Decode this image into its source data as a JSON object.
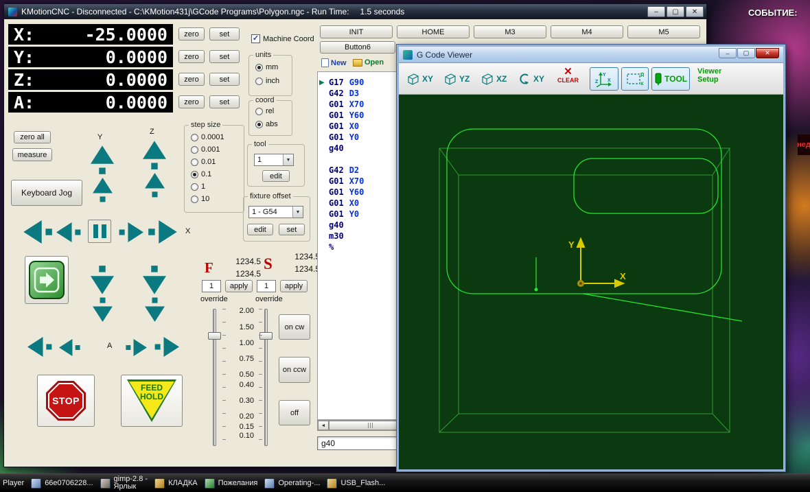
{
  "desktop": {
    "event_label": "СОБЫТИЕ:",
    "side_label": "нед"
  },
  "icons": {
    "minimize": "–",
    "maximize": "▢",
    "close": "✕",
    "play_marker": "▶",
    "scroll_left": "◄",
    "scroll_right": "►",
    "clear_x": "✕",
    "check": "✓",
    "dropdown_arrow": "▼"
  },
  "main_window": {
    "title": "KMotionCNC - Disconnected - C:\\KMotion431j\\GCode Programs\\Polygon.ngc -  Run Time:",
    "run_time": "1.5 seconds",
    "dro": {
      "rows": [
        {
          "label": "X:",
          "value": "-25.0000"
        },
        {
          "label": "Y:",
          "value": "0.0000"
        },
        {
          "label": "Z:",
          "value": "0.0000"
        },
        {
          "label": "A:",
          "value": "0.0000"
        }
      ],
      "zero": "zero",
      "set": "set"
    },
    "machine_coord": "Machine Coord",
    "units": {
      "title": "units",
      "mm": "mm",
      "inch": "inch"
    },
    "coord": {
      "title": "coord",
      "rel": "rel",
      "abs": "abs"
    },
    "step_size": {
      "title": "step size",
      "options": [
        "0.0001",
        "0.001",
        "0.01",
        "0.1",
        "1",
        "10"
      ]
    },
    "tool": {
      "title": "tool",
      "value": "1",
      "edit": "edit"
    },
    "fixture_offset": {
      "title": "fixture offset",
      "value": "1 - G54",
      "edit": "edit",
      "set": "set"
    },
    "zero_all": "zero all",
    "measure": "measure",
    "keyboard_jog": "Keyboard Jog",
    "axis_y": "Y",
    "axis_z": "Z",
    "axis_x": "X",
    "axis_a": "A",
    "stop": "STOP",
    "feed_hold_1": "FEED",
    "feed_hold_2": "HOLD",
    "feed": {
      "f": "F",
      "s": "S",
      "f_value_1": "1234.5",
      "f_value_2": "1234.5",
      "s_value_1": "1234.5",
      "s_value_2": "1234.5",
      "f_input": "1",
      "s_input": "1",
      "apply": "apply",
      "override": "override"
    },
    "slider_ticks": [
      "2.00",
      "1.50",
      "1.00",
      "0.75",
      "0.50",
      "0.40",
      "0.30",
      "0.20",
      "0.15",
      "0.10"
    ],
    "on_cw": "on cw",
    "on_ccw": "on ccw",
    "off": "off",
    "top_buttons": [
      "INIT",
      "HOME",
      "M3",
      "M4",
      "M5"
    ],
    "button6": "Button6",
    "editor": {
      "new": "New",
      "open": "Open",
      "lines": [
        {
          "a": "G17",
          "b": "G90"
        },
        {
          "a": "G42",
          "b": "D3"
        },
        {
          "a": "G01",
          "b": "X70"
        },
        {
          "a": "G01",
          "b": "Y60"
        },
        {
          "a": "G01",
          "b": "X0"
        },
        {
          "a": "G01",
          "b": "Y0"
        },
        {
          "a": "g40",
          "b": ""
        },
        {
          "a": "",
          "b": ""
        },
        {
          "a": "G42",
          "b": "D2"
        },
        {
          "a": "G01",
          "b": "X70"
        },
        {
          "a": "G01",
          "b": "Y60"
        },
        {
          "a": "G01",
          "b": "X0"
        },
        {
          "a": "G01",
          "b": "Y0"
        },
        {
          "a": "g40",
          "b": ""
        },
        {
          "a": "m30",
          "b": ""
        },
        {
          "a": "%",
          "b": ""
        }
      ],
      "command": "g40"
    }
  },
  "viewer": {
    "title": "G Code Viewer",
    "toolbar": {
      "xy": "XY",
      "yz": "YZ",
      "xz": "XZ",
      "rot_xy": "XY",
      "clear": "CLEAR",
      "tool": "TOOL",
      "viewer_setup_line1": "Viewer",
      "viewer_setup_line2": "Setup",
      "axes_icon_y": "Y",
      "axes_icon_x": "X",
      "axes_icon_z": "Z",
      "box_icon_r": "R",
      "box_icon_x": "x"
    },
    "axes": {
      "x": "X",
      "y": "Y"
    }
  },
  "taskbar": {
    "items": [
      {
        "line1": "Player",
        "line2": ""
      },
      {
        "line1": "66e0706228...",
        "line2": ""
      },
      {
        "line1": "gimp-2.8 -",
        "line2": "Ярлык"
      },
      {
        "line1": "КЛАДКА",
        "line2": ""
      },
      {
        "line1": "Пожелания",
        "line2": ""
      },
      {
        "line1": "Operating-...",
        "line2": ""
      },
      {
        "line1": "USB_Flash...",
        "line2": ""
      }
    ]
  }
}
